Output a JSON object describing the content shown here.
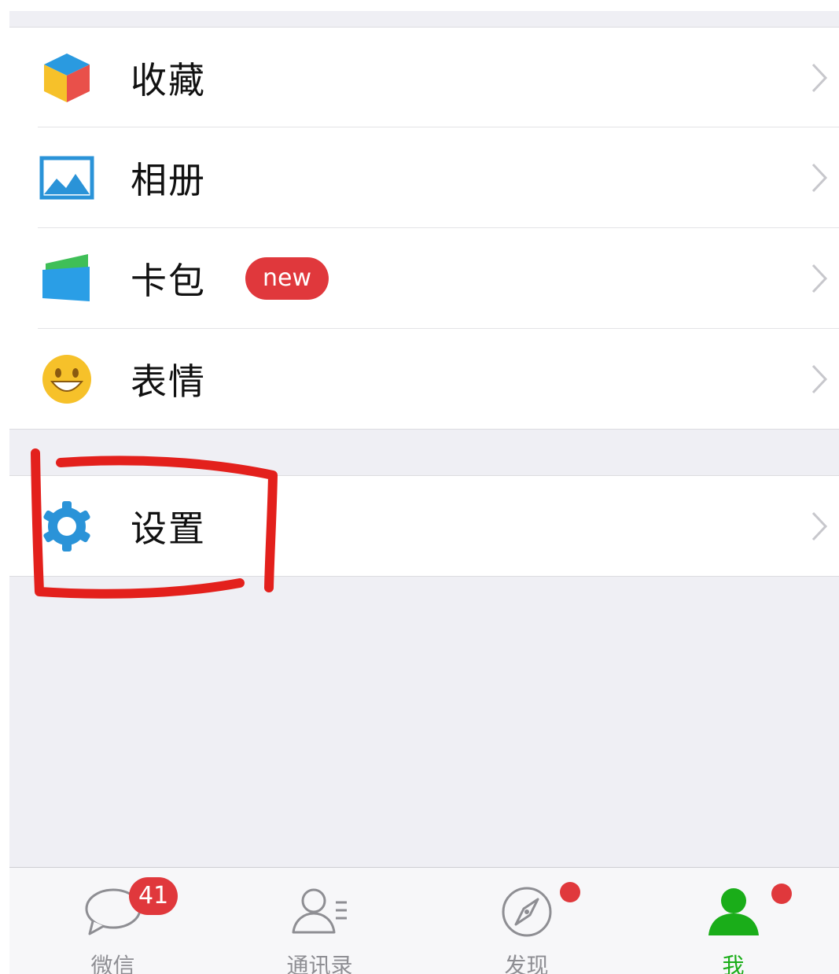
{
  "menu_group": [
    {
      "label": "收藏",
      "icon": "favorites-cube-icon"
    },
    {
      "label": "相册",
      "icon": "album-picture-icon"
    },
    {
      "label": "卡包",
      "icon": "card-wallet-icon",
      "badge": "new"
    },
    {
      "label": "表情",
      "icon": "smiley-face-icon"
    }
  ],
  "settings": {
    "label": "设置",
    "icon": "gear-icon"
  },
  "tabbar": {
    "tabs": [
      {
        "label": "微信",
        "icon": "chat-bubble-icon",
        "badge": "41"
      },
      {
        "label": "通讯录",
        "icon": "contacts-icon"
      },
      {
        "label": "发现",
        "icon": "compass-icon",
        "dot": true
      },
      {
        "label": "我",
        "icon": "person-icon",
        "dot": true,
        "active": true
      }
    ]
  },
  "colors": {
    "accent_green": "#1aad19",
    "badge_red": "#e0383c",
    "background": "#efeff4",
    "annotation_red": "#e3201c"
  }
}
